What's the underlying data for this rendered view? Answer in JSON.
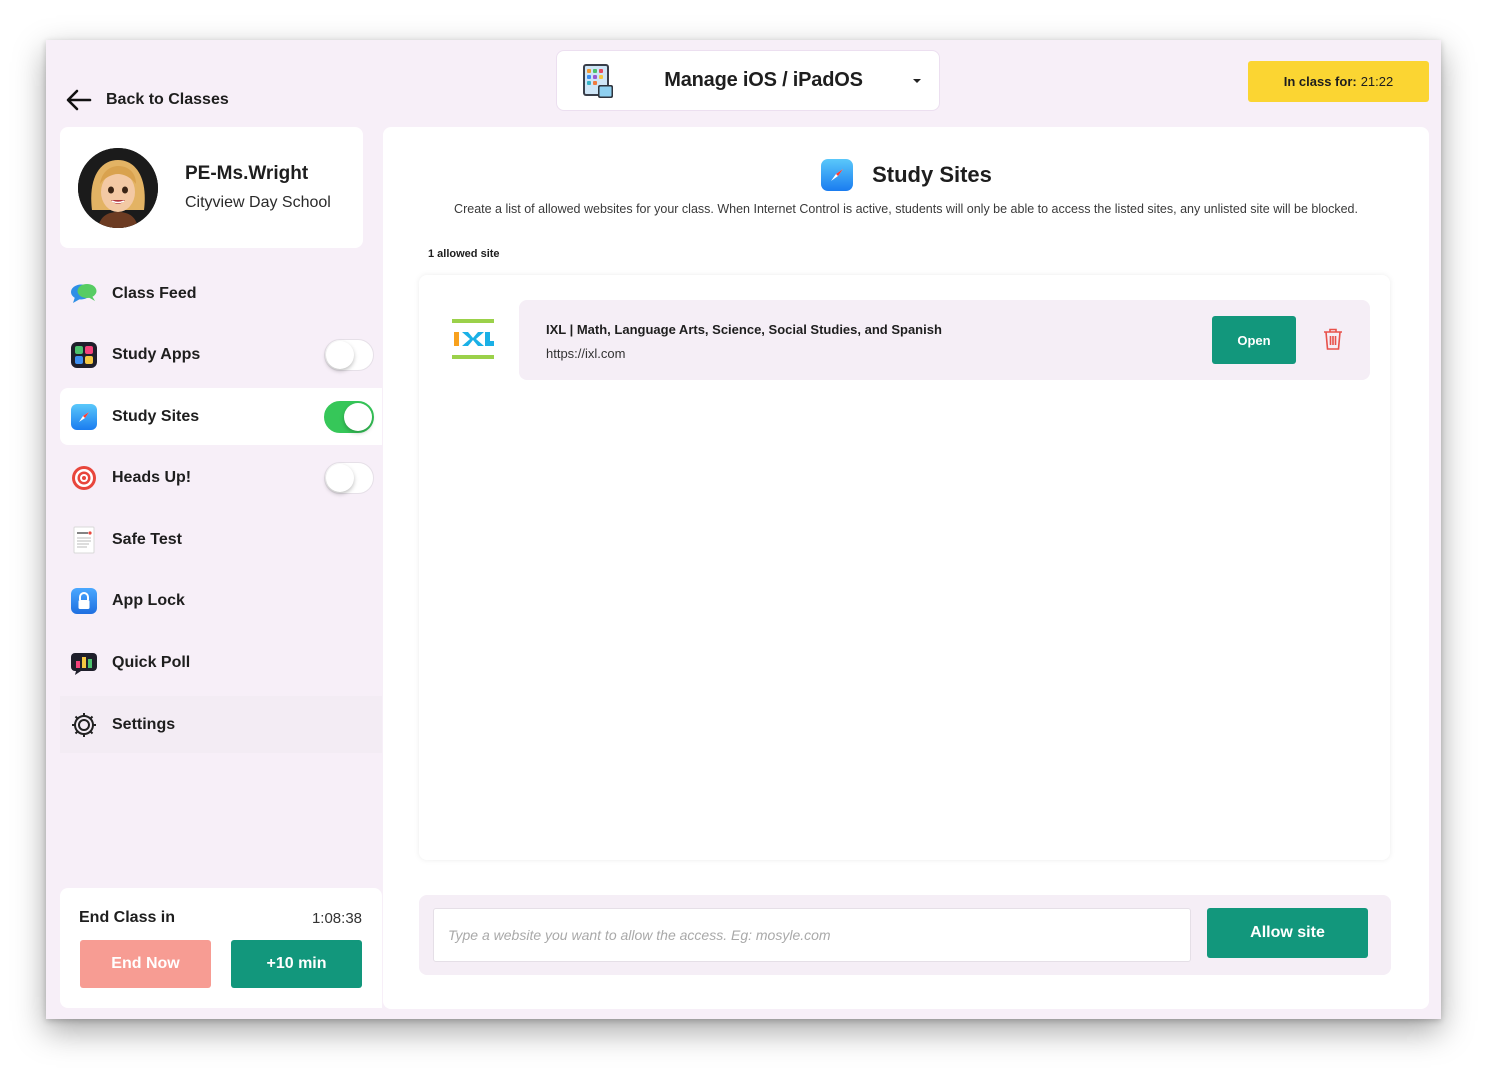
{
  "header": {
    "back_label": "Back to Classes",
    "dropdown_title": "Manage iOS / iPadOS",
    "timer_label": "In class for:",
    "timer_value": "21:22"
  },
  "profile": {
    "name": "PE-Ms.Wright",
    "school": "Cityview Day School"
  },
  "sidebar": {
    "items": [
      {
        "label": "Class Feed",
        "icon": "chat-bubbles-icon"
      },
      {
        "label": "Study Apps",
        "icon": "apps-grid-icon",
        "toggle": false
      },
      {
        "label": "Study Sites",
        "icon": "compass-icon",
        "toggle": true,
        "active": true
      },
      {
        "label": "Heads Up!",
        "icon": "target-icon",
        "toggle": false
      },
      {
        "label": "Safe Test",
        "icon": "document-icon"
      },
      {
        "label": "App Lock",
        "icon": "lock-icon"
      },
      {
        "label": "Quick Poll",
        "icon": "poll-chart-icon"
      },
      {
        "label": "Settings",
        "icon": "gear-icon"
      }
    ]
  },
  "end_class": {
    "label": "End Class in",
    "time": "1:08:38",
    "end_now_label": "End Now",
    "extend_label": "+10 min"
  },
  "main": {
    "title": "Study Sites",
    "description": "Create a list of allowed websites for your class. When Internet Control is active, students will only be able to access the listed sites, any unlisted site will be blocked.",
    "count_label": "1 allowed site",
    "sites": [
      {
        "logo": "IXL",
        "title": "IXL | Math, Language Arts, Science, Social Studies, and Spanish",
        "url": "https://ixl.com",
        "open_label": "Open"
      }
    ],
    "input_placeholder": "Type a website you want to allow the access. Eg: mosyle.com",
    "allow_label": "Allow site"
  },
  "colors": {
    "accent_green": "#12977c",
    "toggle_on": "#36c759",
    "badge_yellow": "#fbd532",
    "end_now_red": "#f79c93",
    "background": "#f7eff8"
  }
}
